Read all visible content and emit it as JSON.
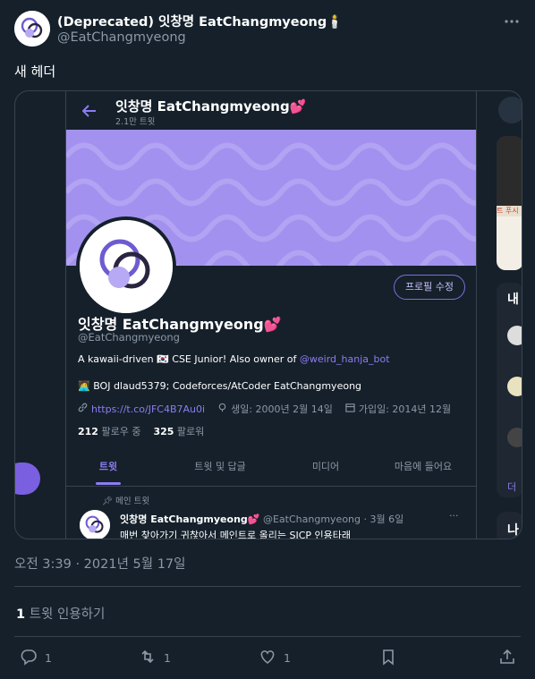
{
  "tweet": {
    "author_name": "(Deprecated) 잇창명 EatChangmyeong🕯️",
    "author_handle": "@EatChangmyeong",
    "text": "새 헤더",
    "timestamp": "오전 3:39 · 2021년 5월 17일",
    "quote_count": "1",
    "quote_label": "트윗 인용하기",
    "actions": {
      "reply_count": "1",
      "retweet_count": "1",
      "like_count": "1"
    }
  },
  "screenshot": {
    "profile_title": "잇창명 EatChangmyeong💕",
    "tweet_count": "2.1만 트윗",
    "edit_profile_label": "프로필 수정",
    "name": "잇창명 EatChangmyeong💕",
    "handle": "@EatChangmyeong",
    "bio_line1_prefix": "A kawaii-driven 🇰🇷 CSE Junior! Also owner of ",
    "bio_line1_link": "@weird_hanja_bot",
    "bio_line2": "🧑‍💻 BOJ dlaud5379; Codeforces/AtCoder EatChangmyeong",
    "url": "https://t.co/JFC4B7Au0i",
    "birthday": "생일: 2000년 2월 14일",
    "joined": "가입일: 2014년 12월",
    "following_count": "212",
    "following_label": "팔로우 중",
    "followers_count": "325",
    "followers_label": "팔로워",
    "tabs": [
      "트윗",
      "트윗 및 답글",
      "미디어",
      "마음에 들어요"
    ],
    "pinned_label": "메인 트윗",
    "inner_name": "잇창명 EatChangmyeong💕",
    "inner_meta": "@EatChangmyeong · 3월 6일",
    "inner_text": "매번 찾아가기 귀찮아서 메인트로 올리는 SICP 인용타래",
    "inner_more": "···",
    "right_fragments": {
      "trend_text": "트 푸시",
      "section_char": "내",
      "more_char": "더",
      "bottom_char": "나"
    }
  },
  "colors": {
    "background": "#15202b",
    "accent": "#8d7cf0",
    "banner": "#a391ef",
    "border": "#38444d",
    "muted": "#8b98a5"
  },
  "icons": [
    "more-icon",
    "back-arrow-icon",
    "link-icon",
    "birthday-icon",
    "calendar-icon",
    "pin-icon",
    "reply-icon",
    "retweet-icon",
    "like-icon",
    "bookmark-icon",
    "share-icon"
  ]
}
